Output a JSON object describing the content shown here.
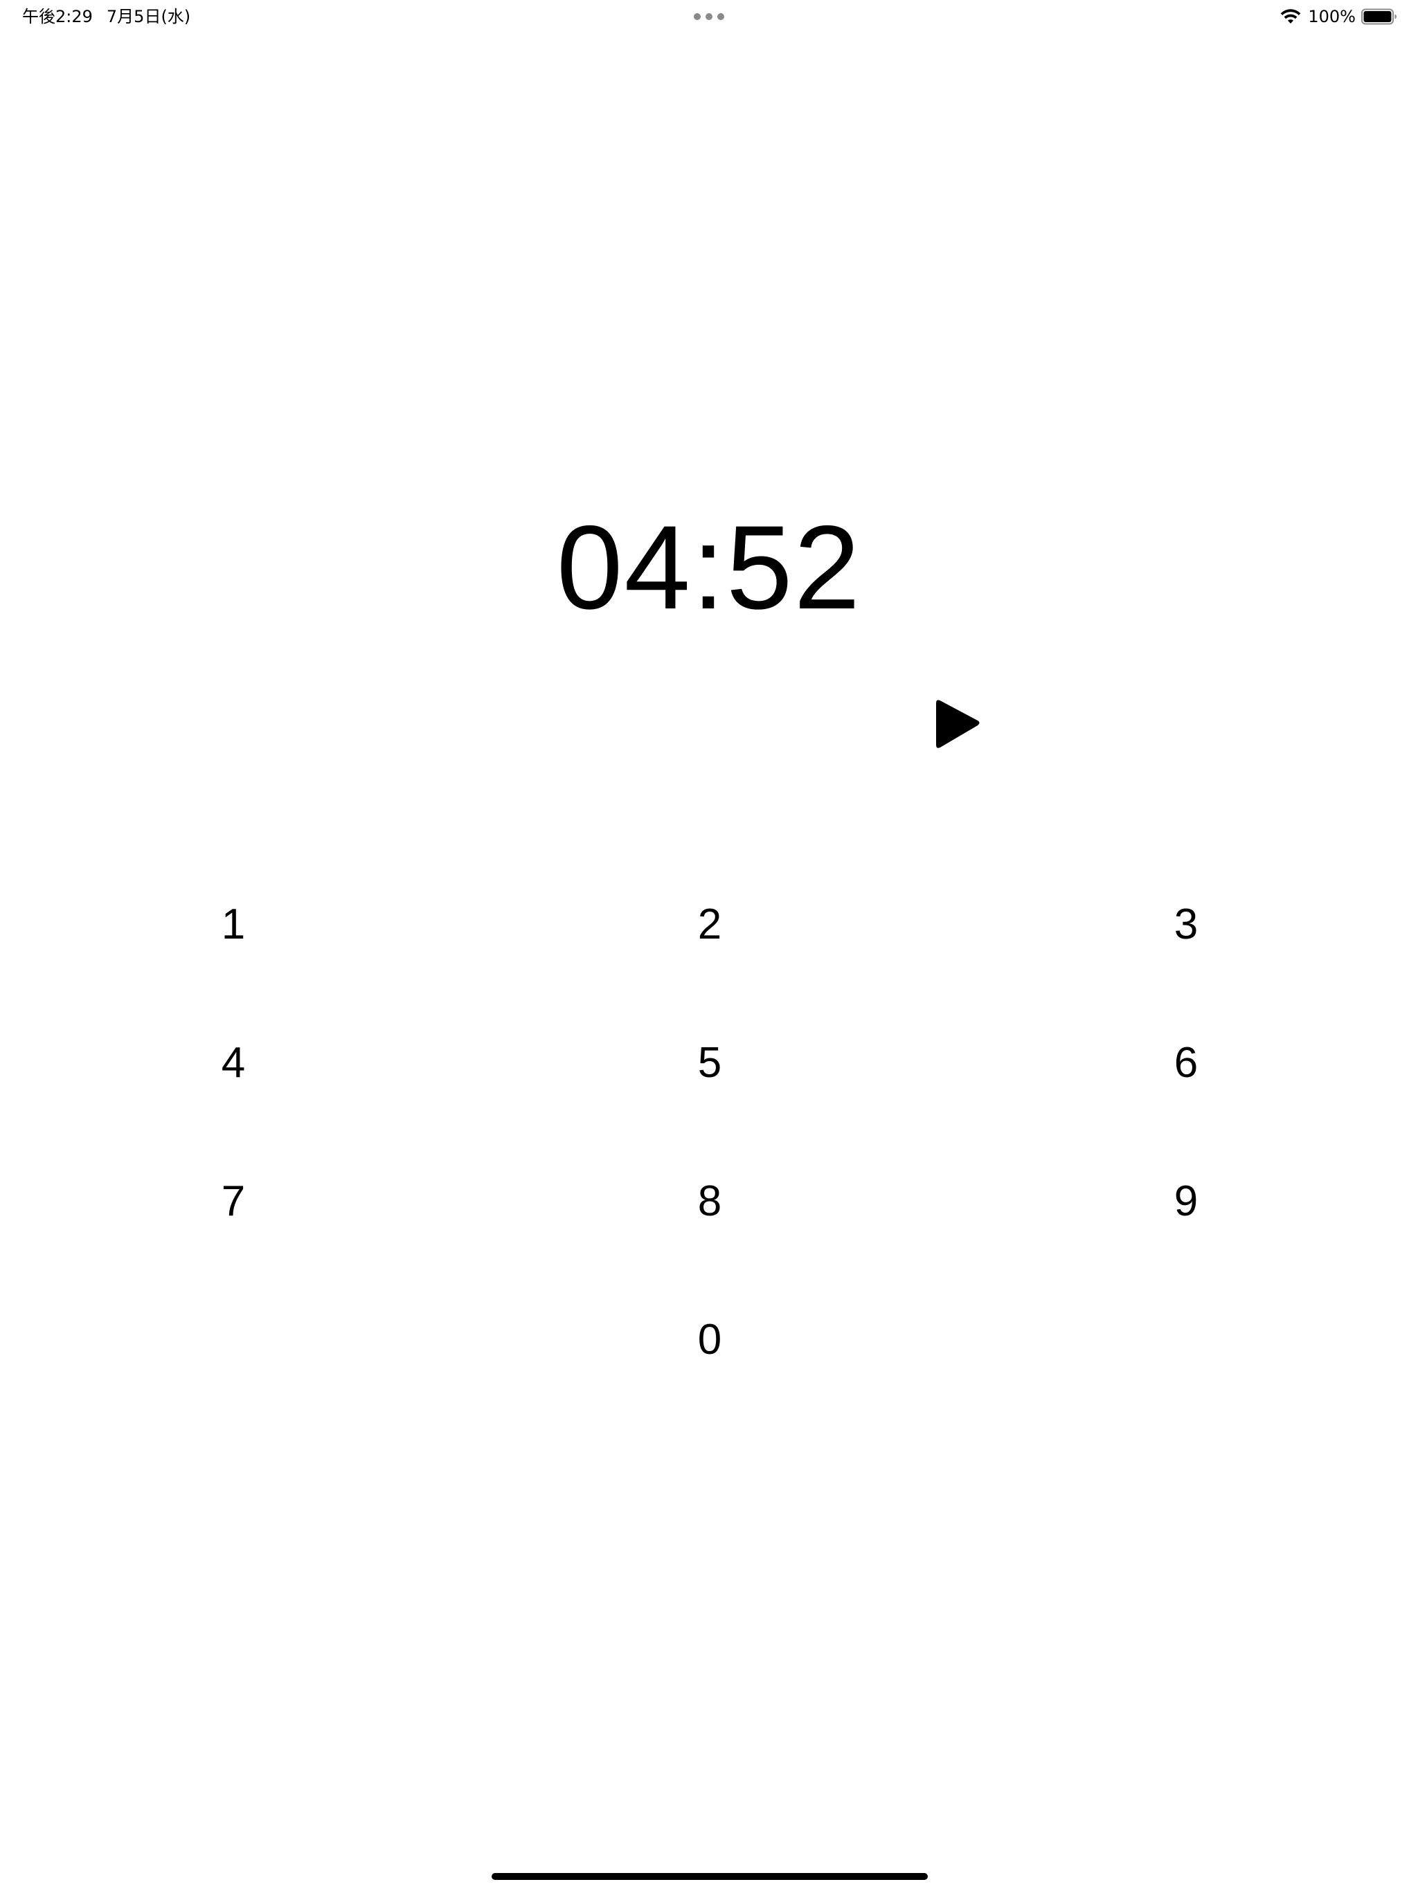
{
  "status_bar": {
    "time": "午後2:29",
    "date": "7月5日(水)",
    "battery_percent": "100%",
    "battery_level": 1.0,
    "wifi_icon": "wifi-icon",
    "battery_icon": "battery-icon",
    "multitask_icon": "multitasking-dots-icon"
  },
  "timer": {
    "display": "04:52"
  },
  "controls": {
    "play_icon": "play-icon"
  },
  "keypad": {
    "keys": [
      "1",
      "2",
      "3",
      "4",
      "5",
      "6",
      "7",
      "8",
      "9",
      "0"
    ]
  },
  "colors": {
    "background": "#ffffff",
    "foreground": "#000000",
    "dots": "#8a8a8e"
  }
}
